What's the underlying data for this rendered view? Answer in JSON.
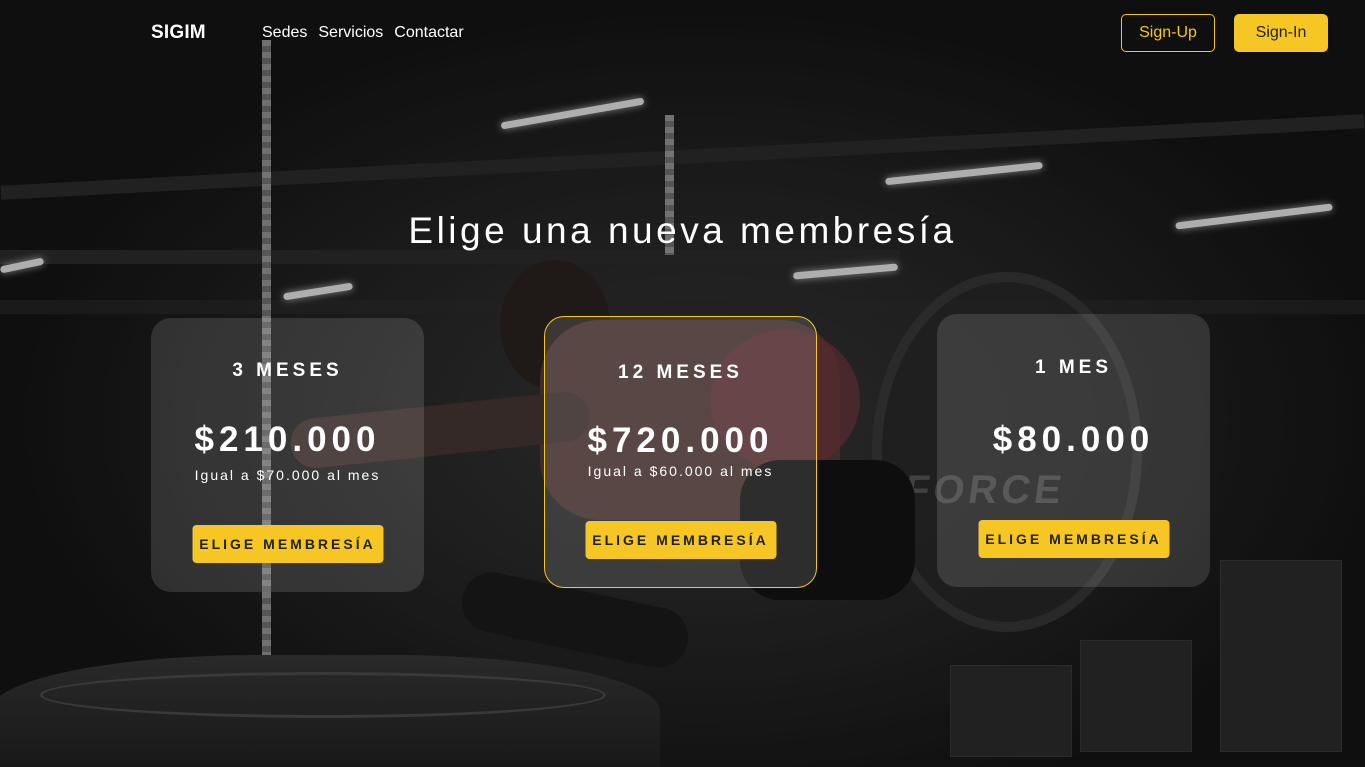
{
  "nav": {
    "logo": "SIGIM",
    "links": [
      "Sedes",
      "Servicios",
      "Contactar"
    ],
    "signup": "Sign-Up",
    "signin": "Sign-In"
  },
  "heading": "Elige una nueva membresía",
  "plans": [
    {
      "title": "3 MESES",
      "price": "$210.000",
      "note": "Igual a $70.000 al mes",
      "button": "ELIGE MEMBRESÍA",
      "featured": false
    },
    {
      "title": "12 MESES",
      "price": "$720.000",
      "note": "Igual a $60.000 al mes",
      "button": "ELIGE MEMBRESÍA",
      "featured": true
    },
    {
      "title": "1 MES",
      "price": "$80.000",
      "note": "",
      "button": "ELIGE MEMBRESÍA",
      "featured": false
    }
  ],
  "colors": {
    "accent": "#f6c624",
    "dark": "#222222"
  }
}
